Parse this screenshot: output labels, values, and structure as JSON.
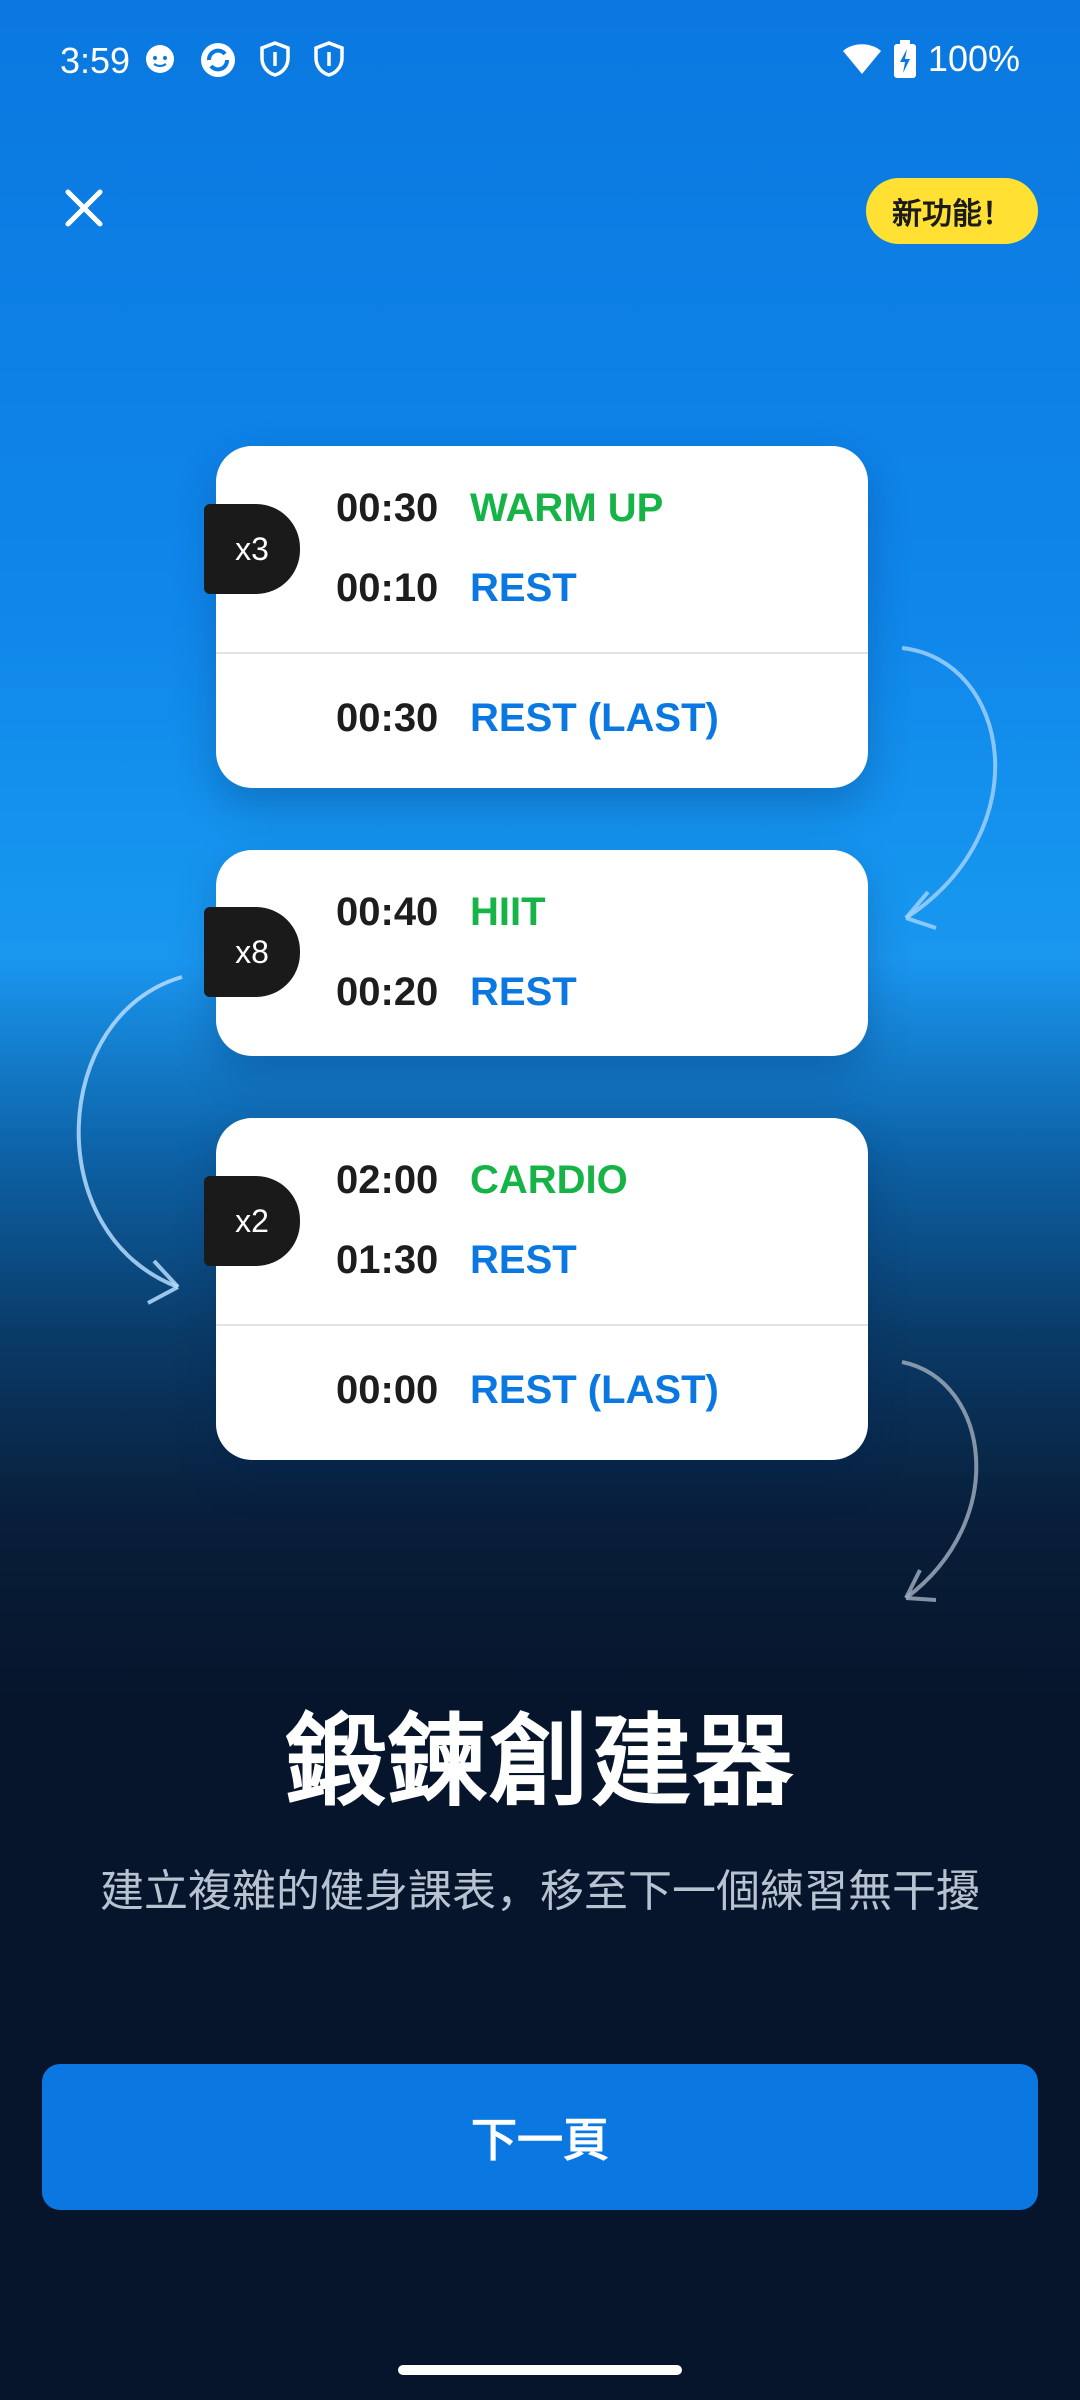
{
  "status_bar": {
    "time": "3:59",
    "battery": "100%",
    "icons": [
      "cat-notification-icon",
      "sync-icon",
      "shield-icon",
      "shield-icon",
      "wifi-icon",
      "battery-charging-icon"
    ]
  },
  "header": {
    "close_icon": "close-icon",
    "badge": "新功能！"
  },
  "blocks": [
    {
      "repeat": "x3",
      "rows": [
        {
          "time": "00:30",
          "label": "WARM UP",
          "color": "green"
        },
        {
          "time": "00:10",
          "label": "REST",
          "color": "blue"
        }
      ],
      "last": {
        "time": "00:30",
        "label": "REST (LAST)",
        "color": "blue"
      }
    },
    {
      "repeat": "x8",
      "rows": [
        {
          "time": "00:40",
          "label": "HIIT",
          "color": "green"
        },
        {
          "time": "00:20",
          "label": "REST",
          "color": "blue"
        }
      ]
    },
    {
      "repeat": "x2",
      "rows": [
        {
          "time": "02:00",
          "label": "CARDIO",
          "color": "green"
        },
        {
          "time": "01:30",
          "label": "REST",
          "color": "blue"
        }
      ],
      "last": {
        "time": "00:00",
        "label": "REST (LAST)",
        "color": "blue"
      }
    }
  ],
  "main": {
    "title": "鍛鍊創建器",
    "subtitle": "建立複雜的健身課表，移至下一個練習無干擾"
  },
  "footer": {
    "next_label": "下一頁"
  },
  "colors": {
    "accent": "#0a78e0",
    "green": "#16b446",
    "badge": "#ffe033",
    "dark_bg": "#06152b"
  }
}
